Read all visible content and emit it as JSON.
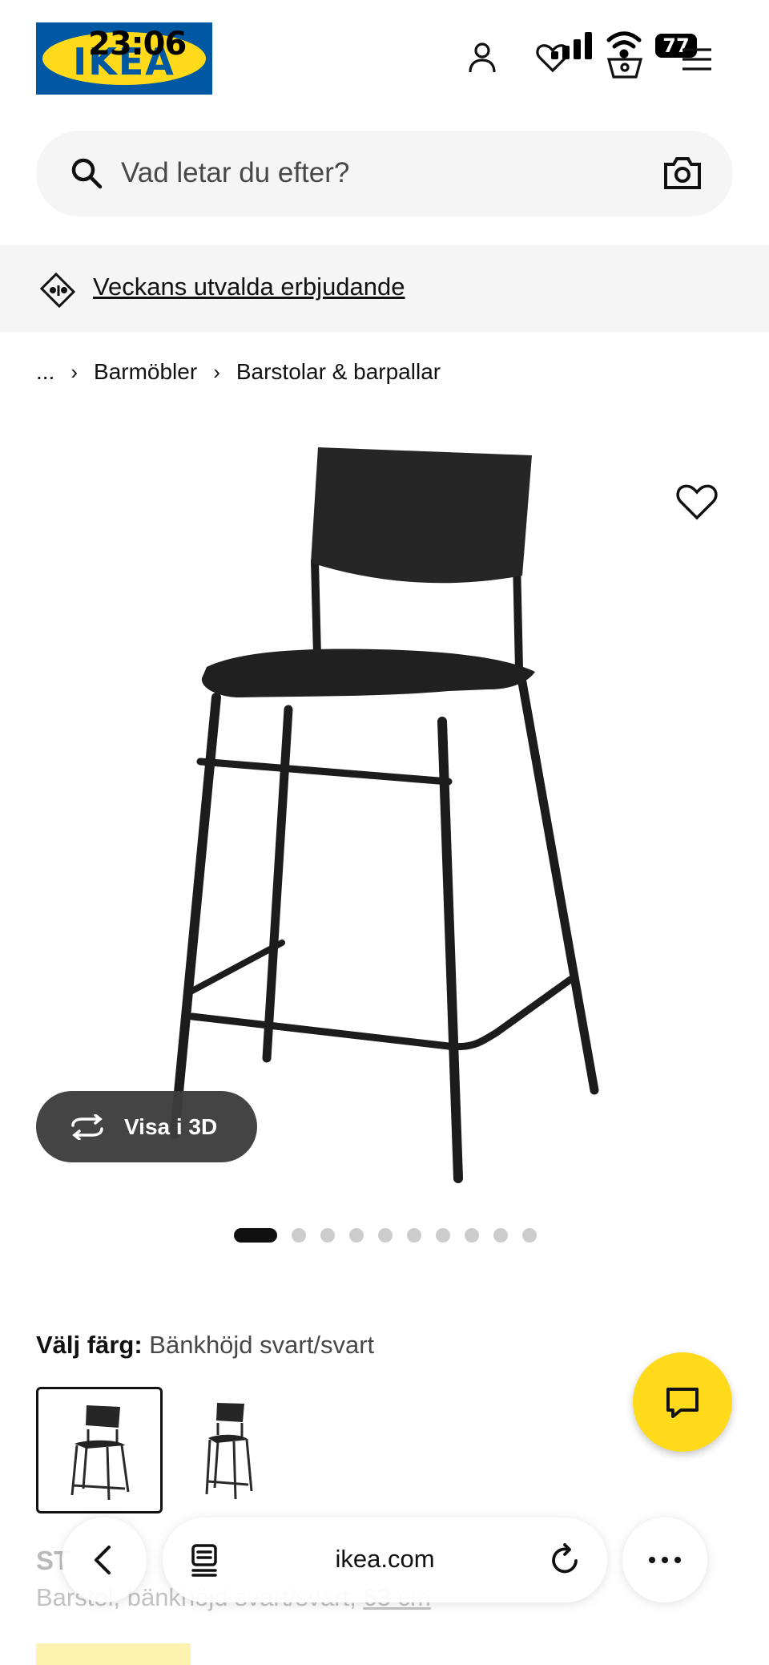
{
  "status_bar": {
    "time": "23:06",
    "battery": "77"
  },
  "brand": {
    "logo_text": "IKEA",
    "colors": {
      "blue": "#0058a3",
      "yellow": "#ffda1a"
    }
  },
  "header": {
    "icons": [
      "user-icon",
      "heart-icon",
      "basket-icon",
      "menu-icon"
    ]
  },
  "search": {
    "placeholder": "Vad letar du efter?"
  },
  "promo": {
    "label": "Veckans utvalda erbjudande"
  },
  "breadcrumb": {
    "ellipsis": "...",
    "items": [
      "Barmöbler",
      "Barstolar & barpallar"
    ]
  },
  "gallery": {
    "view_3d_label": "Visa i 3D",
    "image_count": 10,
    "active_index": 0
  },
  "color_select": {
    "label": "Välj färg:",
    "value": "Bänkhöjd svart/svart"
  },
  "product": {
    "name_partial": "ST",
    "description_partial": "Barstol, bänkhöjd svart/svart,",
    "description_link": "63 cm"
  },
  "browser": {
    "url": "ikea.com"
  }
}
